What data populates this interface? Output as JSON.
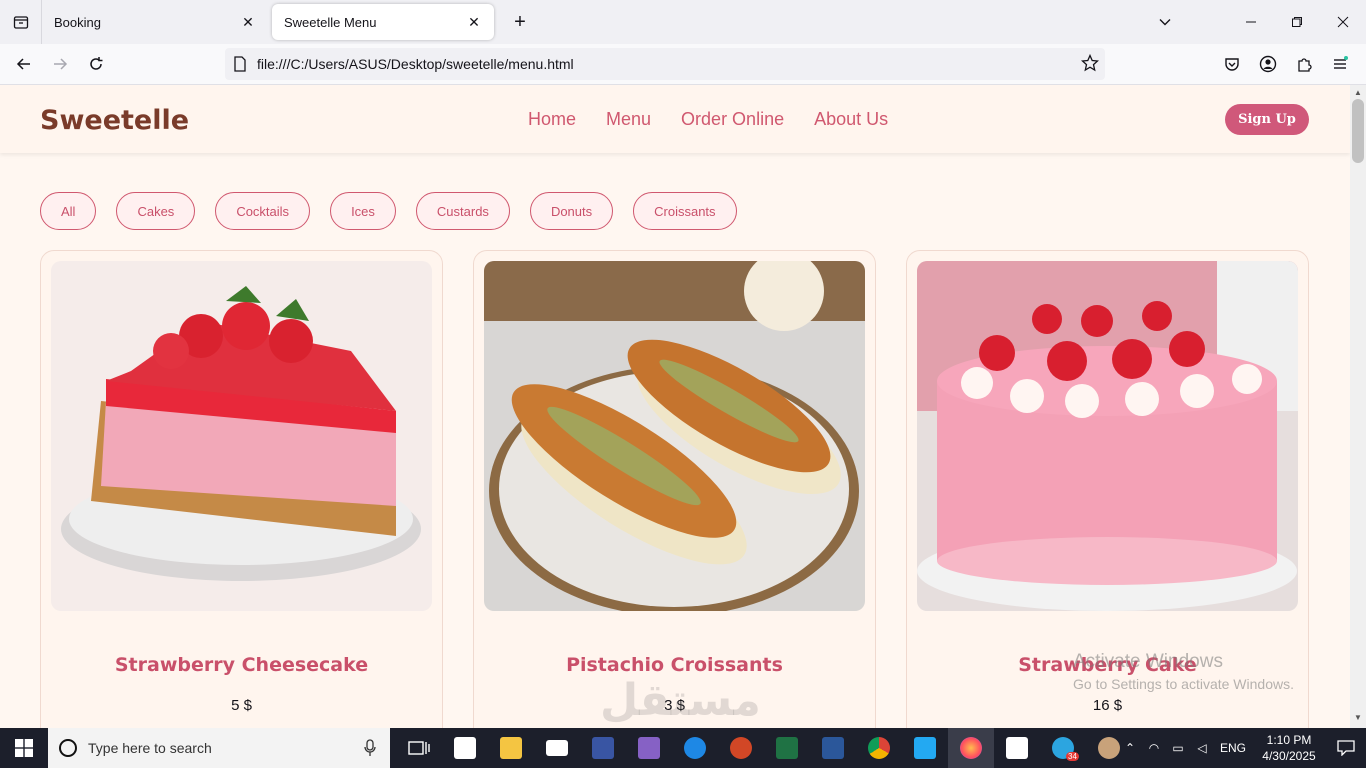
{
  "browser": {
    "tabs": [
      {
        "label": "Booking",
        "active": false
      },
      {
        "label": "Sweetelle Menu",
        "active": true
      }
    ],
    "url": "file:///C:/Users/ASUS/Desktop/sweetelle/menu.html"
  },
  "site": {
    "logo": "Sweetelle",
    "nav": [
      "Home",
      "Menu",
      "Order Online",
      "About Us"
    ],
    "signup_label": "Sign Up",
    "filters": [
      "All",
      "Cakes",
      "Cocktails",
      "Ices",
      "Custards",
      "Donuts",
      "Croissants"
    ],
    "products": [
      {
        "name": "Strawberry Cheesecake",
        "price": "5 $"
      },
      {
        "name": "Pistachio Croissants",
        "price": "3 $"
      },
      {
        "name": "Strawberry Cake",
        "price": "16 $"
      }
    ]
  },
  "watermark": {
    "line1": "Activate Windows",
    "line2": "Go to Settings to activate Windows.",
    "mostaql": "مستقل"
  },
  "taskbar": {
    "search_placeholder": "Type here to search",
    "language": "ENG",
    "time": "1:10 PM",
    "date": "4/30/2025",
    "telegram_badge": "34"
  },
  "colors": {
    "brand_pink": "#d0586f",
    "logo_brown": "#7a3b2a",
    "page_bg": "#fff7f1"
  }
}
